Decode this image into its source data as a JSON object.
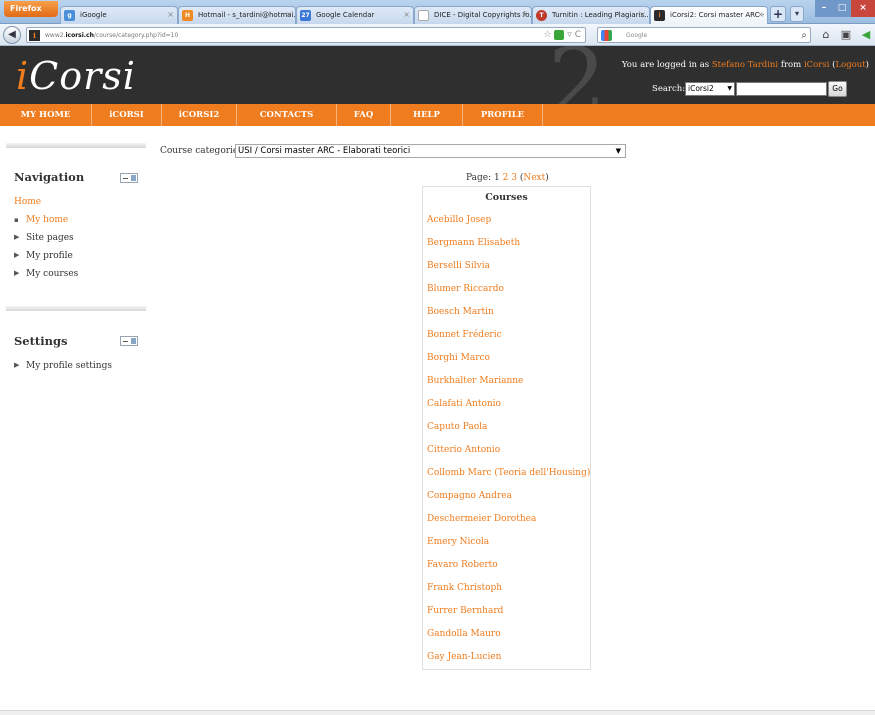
{
  "browser": {
    "menu_button": "Firefox",
    "tabs": [
      {
        "title": "iGoogle",
        "color": "#4a8fd8",
        "favicon": "g"
      },
      {
        "title": "Hotmail - s_tardini@hotmai...",
        "color": "#f08a24",
        "favicon": "H"
      },
      {
        "title": "Google Calendar",
        "color": "#3b78d8",
        "favicon": "27"
      },
      {
        "title": "DICE - Digital Copyrights fo...",
        "color": "#cccccc",
        "favicon": ""
      },
      {
        "title": "Turnitin : Leading Plagiaris...",
        "color": "#c0392b",
        "favicon": "T"
      },
      {
        "title": "iCorsi2: Corsi master ARC - ...",
        "color": "#2b2b2b",
        "favicon": "i"
      }
    ],
    "new_tab": "+",
    "url_prefix": "www2.",
    "url_domain": "icorsi.ch",
    "url_path": "/course/category.php?id=10",
    "reload": "C",
    "search_placeholder": "Google",
    "search_icon": "search-icon",
    "home_icon": "home-icon"
  },
  "header": {
    "logo_i": "i",
    "logo_rest": "Corsi",
    "background_digit": "2",
    "logged_prefix": "You are logged in as ",
    "user_name": "Stefano Tardini",
    "logged_from": " from ",
    "site_name": "iCorsi",
    "logout": "Logout",
    "search_label": "Search:",
    "search_scope": "iCorsi2",
    "search_value": "",
    "go_button": "Go"
  },
  "menu": [
    {
      "label": "MY HOME"
    },
    {
      "label": "iCORSI"
    },
    {
      "label": "iCORSI2"
    },
    {
      "label": "CONTACTS"
    },
    {
      "label": "FAQ"
    },
    {
      "label": "HELP"
    },
    {
      "label": "PROFILE"
    }
  ],
  "navigation": {
    "title": "Navigation",
    "home": "Home",
    "items": [
      {
        "label": "My home"
      },
      {
        "label": "Site pages"
      },
      {
        "label": "My profile"
      },
      {
        "label": "My courses"
      }
    ]
  },
  "settings": {
    "title": "Settings",
    "items": [
      {
        "label": "My profile settings"
      }
    ]
  },
  "main": {
    "category_label": "Course categories:",
    "category_value": "USI / Corsi master ARC - Elaborati teorici",
    "page_label": "Page:",
    "pages": [
      "1",
      "2",
      "3"
    ],
    "next": "Next",
    "courses_heading": "Courses",
    "courses": [
      "Acebillo Josep",
      "Bergmann Elisabeth",
      "Berselli Silvia",
      "Blumer Riccardo",
      "Boesch Martin",
      "Bonnet Fréderic",
      "Borghi Marco",
      "Burkhalter Marianne",
      "Calafati Antonio",
      "Caputo Paola",
      "Citterio Antonio",
      "Collomb Marc (Teoria dell'Housing)",
      "Compagno Andrea",
      "Deschermeier Dorothea",
      "Emery Nicola",
      "Favaro Roberto",
      "Frank Christoph",
      "Furrer Bernhard",
      "Gandolla Mauro",
      "Gay Jean-Lucien"
    ]
  },
  "colors": {
    "accent": "#ef7c1e",
    "header_bg": "#2f2f2f"
  }
}
